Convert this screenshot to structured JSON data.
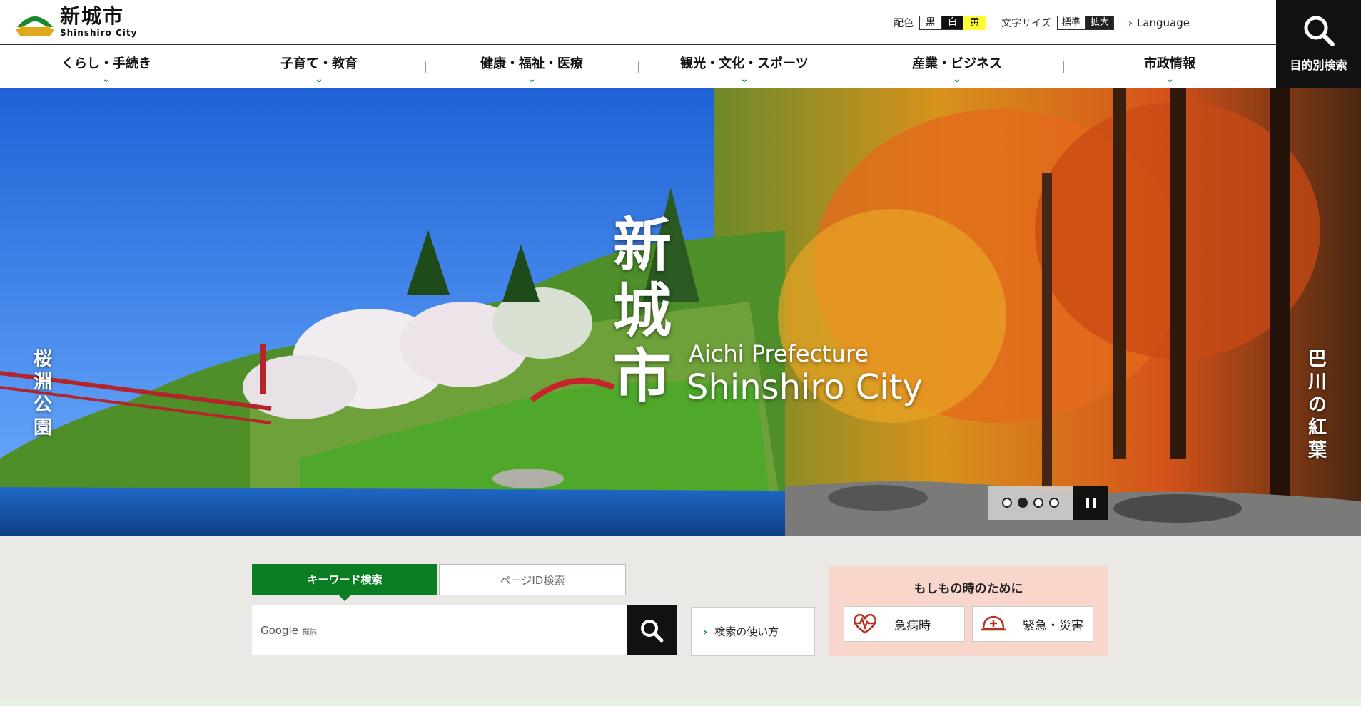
{
  "header": {
    "logo_jp": "新城市",
    "logo_en": "Shinshiro City",
    "color_label": "配色",
    "color_options": [
      "黒",
      "白",
      "黄"
    ],
    "font_label": "文字サイズ",
    "font_options": [
      "標準",
      "拡大"
    ],
    "language_label": "Language",
    "search_label": "目的別検索"
  },
  "nav": {
    "items": [
      {
        "label": "くらし・手続き"
      },
      {
        "label": "子育て・教育"
      },
      {
        "label": "健康・福祉・医療"
      },
      {
        "label": "観光・文化・スポーツ"
      },
      {
        "label": "産業・ビジネス"
      },
      {
        "label": "市政情報"
      }
    ]
  },
  "hero": {
    "title_jp": "新城市",
    "title_en_line1": "Aichi Prefecture",
    "title_en_line2": "Shinshiro City",
    "caption_left": "桜淵公園",
    "caption_right": "巴川の紅葉",
    "slides_total": 4,
    "slide_active": 2
  },
  "search": {
    "tab_keyword": "キーワード検索",
    "tab_pageid": "ページID検索",
    "input_brand": "Google",
    "input_provided": "提供",
    "howto_label": "検索の使い方"
  },
  "emergency": {
    "title": "もしもの時のために",
    "btn_sudden": "急病時",
    "btn_disaster": "緊急・災害"
  },
  "colors": {
    "brand_green": "#0b7d22",
    "emergency_bg": "#f9d6cc",
    "search_bg": "#eae9e5"
  }
}
